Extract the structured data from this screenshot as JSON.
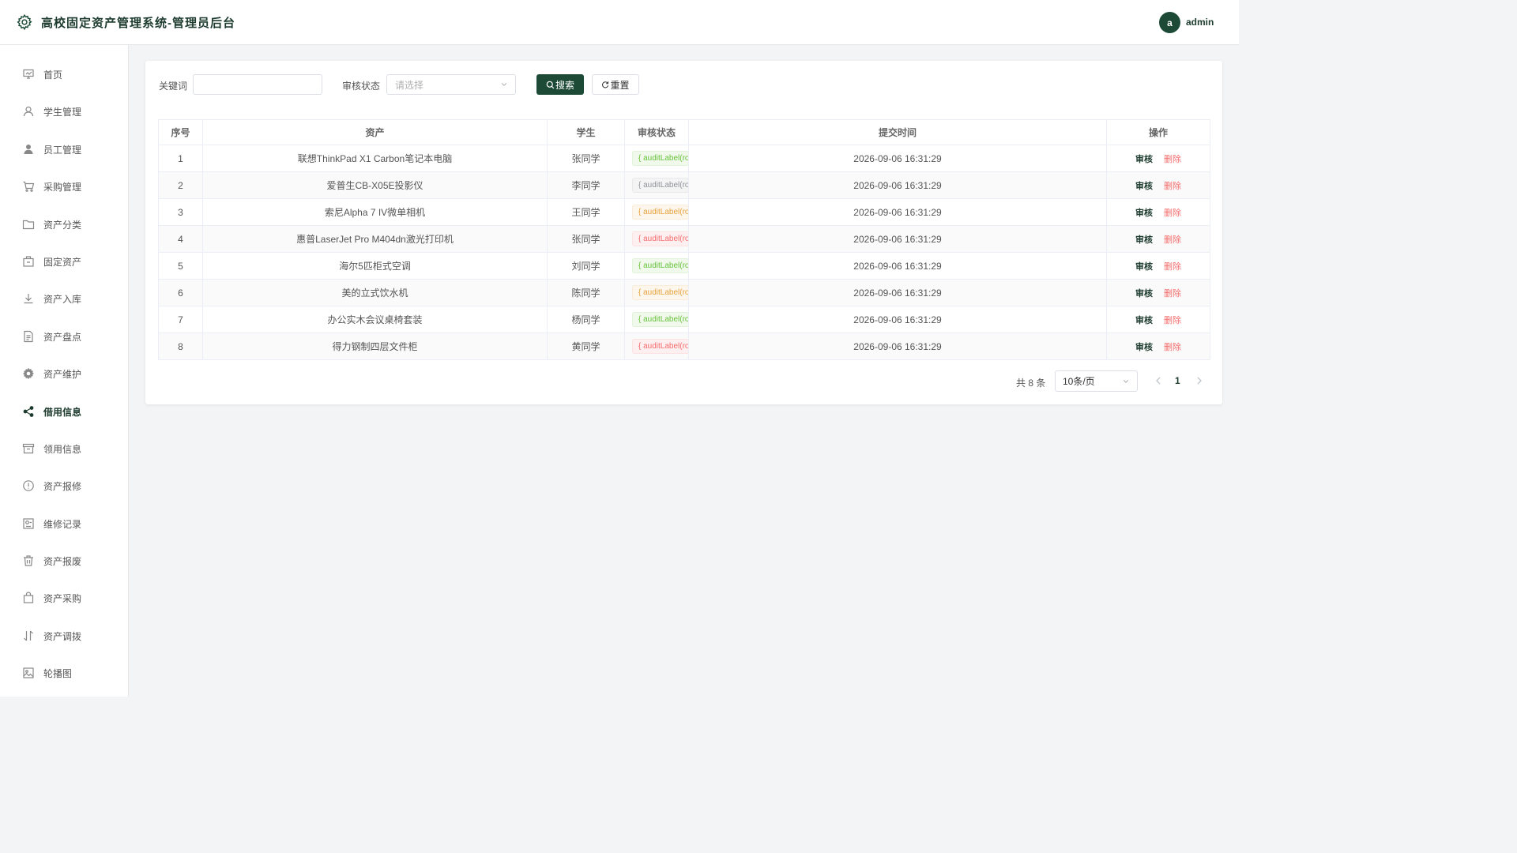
{
  "header": {
    "title": "高校固定资产管理系统-管理员后台",
    "avatar_letter": "a",
    "username": "admin"
  },
  "sidebar": {
    "items": [
      {
        "label": "首页",
        "icon": "dashboard-icon"
      },
      {
        "label": "学生管理",
        "icon": "user-icon"
      },
      {
        "label": "员工管理",
        "icon": "user-filled-icon"
      },
      {
        "label": "采购管理",
        "icon": "shopping-cart-icon"
      },
      {
        "label": "资产分类",
        "icon": "folder-icon"
      },
      {
        "label": "固定资产",
        "icon": "box-icon"
      },
      {
        "label": "资产入库",
        "icon": "download-icon"
      },
      {
        "label": "资产盘点",
        "icon": "document-icon"
      },
      {
        "label": "资产维护",
        "icon": "gear-icon"
      },
      {
        "label": "借用信息",
        "icon": "share-icon",
        "active": true
      },
      {
        "label": "领用信息",
        "icon": "archive-icon"
      },
      {
        "label": "资产报修",
        "icon": "warning-circle-icon"
      },
      {
        "label": "维修记录",
        "icon": "tools-icon"
      },
      {
        "label": "资产报废",
        "icon": "trash-icon"
      },
      {
        "label": "资产采购",
        "icon": "shopping-bag-icon"
      },
      {
        "label": "资产调拨",
        "icon": "sort-icon"
      },
      {
        "label": "轮播图",
        "icon": "picture-icon"
      }
    ]
  },
  "search": {
    "keyword_label": "关键词",
    "keyword_value": "",
    "status_label": "审核状态",
    "status_placeholder": "请选择",
    "search_button": "搜索",
    "reset_button": "重置"
  },
  "table": {
    "headers": [
      "序号",
      "资产",
      "学生",
      "审核状态",
      "提交时间",
      "操作"
    ],
    "rows": [
      {
        "no": "1",
        "asset": "联想ThinkPad X1 Carbon笔记本电脑",
        "student": "张同学",
        "status": "{ auditLabel(row.auditStatus) }",
        "status_type": "success",
        "time": "2026-09-06 16:31:29"
      },
      {
        "no": "2",
        "asset": "爱普生CB-X05E投影仪",
        "student": "李同学",
        "status": "{ auditLabel(row.auditStatus) }",
        "status_type": "info",
        "time": "2026-09-06 16:31:29"
      },
      {
        "no": "3",
        "asset": "索尼Alpha 7 IV微单相机",
        "student": "王同学",
        "status": "{ auditLabel(row.auditStatus) }",
        "status_type": "warning",
        "time": "2026-09-06 16:31:29"
      },
      {
        "no": "4",
        "asset": "惠普LaserJet Pro M404dn激光打印机",
        "student": "张同学",
        "status": "{ auditLabel(row.auditStatus) }",
        "status_type": "danger",
        "time": "2026-09-06 16:31:29"
      },
      {
        "no": "5",
        "asset": "海尔5匹柜式空调",
        "student": "刘同学",
        "status": "{ auditLabel(row.auditStatus) }",
        "status_type": "success",
        "time": "2026-09-06 16:31:29"
      },
      {
        "no": "6",
        "asset": "美的立式饮水机",
        "student": "陈同学",
        "status": "{ auditLabel(row.auditStatus) }",
        "status_type": "warning",
        "time": "2026-09-06 16:31:29"
      },
      {
        "no": "7",
        "asset": "办公实木会议桌椅套装",
        "student": "杨同学",
        "status": "{ auditLabel(row.auditStatus) }",
        "status_type": "success",
        "time": "2026-09-06 16:31:29"
      },
      {
        "no": "8",
        "asset": "得力钢制四层文件柜",
        "student": "黄同学",
        "status": "{ auditLabel(row.auditStatus) }",
        "status_type": "danger",
        "time": "2026-09-06 16:31:29"
      }
    ],
    "audit_label": "审核",
    "delete_label": "删除"
  },
  "pagination": {
    "total": "共 8 条",
    "page_size": "10条/页",
    "current_page": "1"
  },
  "colors": {
    "primary": "#1d4a37",
    "danger": "#f56c6c"
  }
}
